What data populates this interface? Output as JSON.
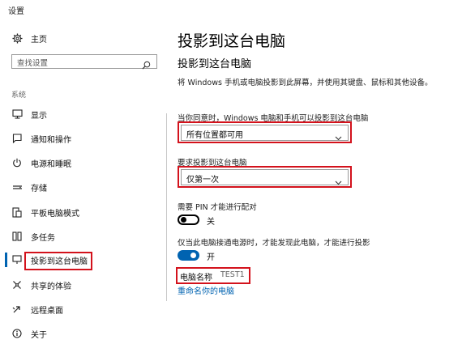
{
  "window": {
    "title": "设置"
  },
  "sidebar": {
    "home_label": "主页",
    "search_placeholder": "查找设置",
    "section_label": "系统",
    "items": [
      {
        "label": "显示",
        "icon": "monitor-icon"
      },
      {
        "label": "通知和操作",
        "icon": "notification-icon"
      },
      {
        "label": "电源和睡眠",
        "icon": "power-icon"
      },
      {
        "label": "存储",
        "icon": "storage-icon"
      },
      {
        "label": "平板电脑模式",
        "icon": "tablet-mode-icon"
      },
      {
        "label": "多任务",
        "icon": "multitasking-icon"
      },
      {
        "label": "投影到这台电脑",
        "icon": "project-icon",
        "selected": true
      },
      {
        "label": "共享的体验",
        "icon": "shared-experience-icon"
      },
      {
        "label": "远程桌面",
        "icon": "remote-desktop-icon"
      },
      {
        "label": "关于",
        "icon": "info-icon"
      }
    ]
  },
  "main": {
    "page_title": "投影到这台电脑",
    "subtitle": "投影到这台电脑",
    "description": "将 Windows 手机或电脑投影到此屏幕，并使用其键盘、鼠标和其他设备。",
    "availability_label": "当你同意时，Windows 电脑和手机可以投影到这台电脑",
    "availability_value": "所有位置都可用",
    "request_label": "要求投影到这台电脑",
    "request_value": "仅第一次",
    "pin_label": "需要 PIN 才能进行配对",
    "pin_state": "关",
    "pin_on": false,
    "power_label": "仅当此电脑接通电源时，才能发现此电脑，才能进行投影",
    "power_state": "开",
    "power_on": true,
    "pc_name_label": "电脑名称",
    "pc_name_value": "TEST1",
    "rename_link": "重命名你的电脑"
  },
  "colors": {
    "accent": "#0063b1",
    "highlight_box": "#d3121c"
  }
}
